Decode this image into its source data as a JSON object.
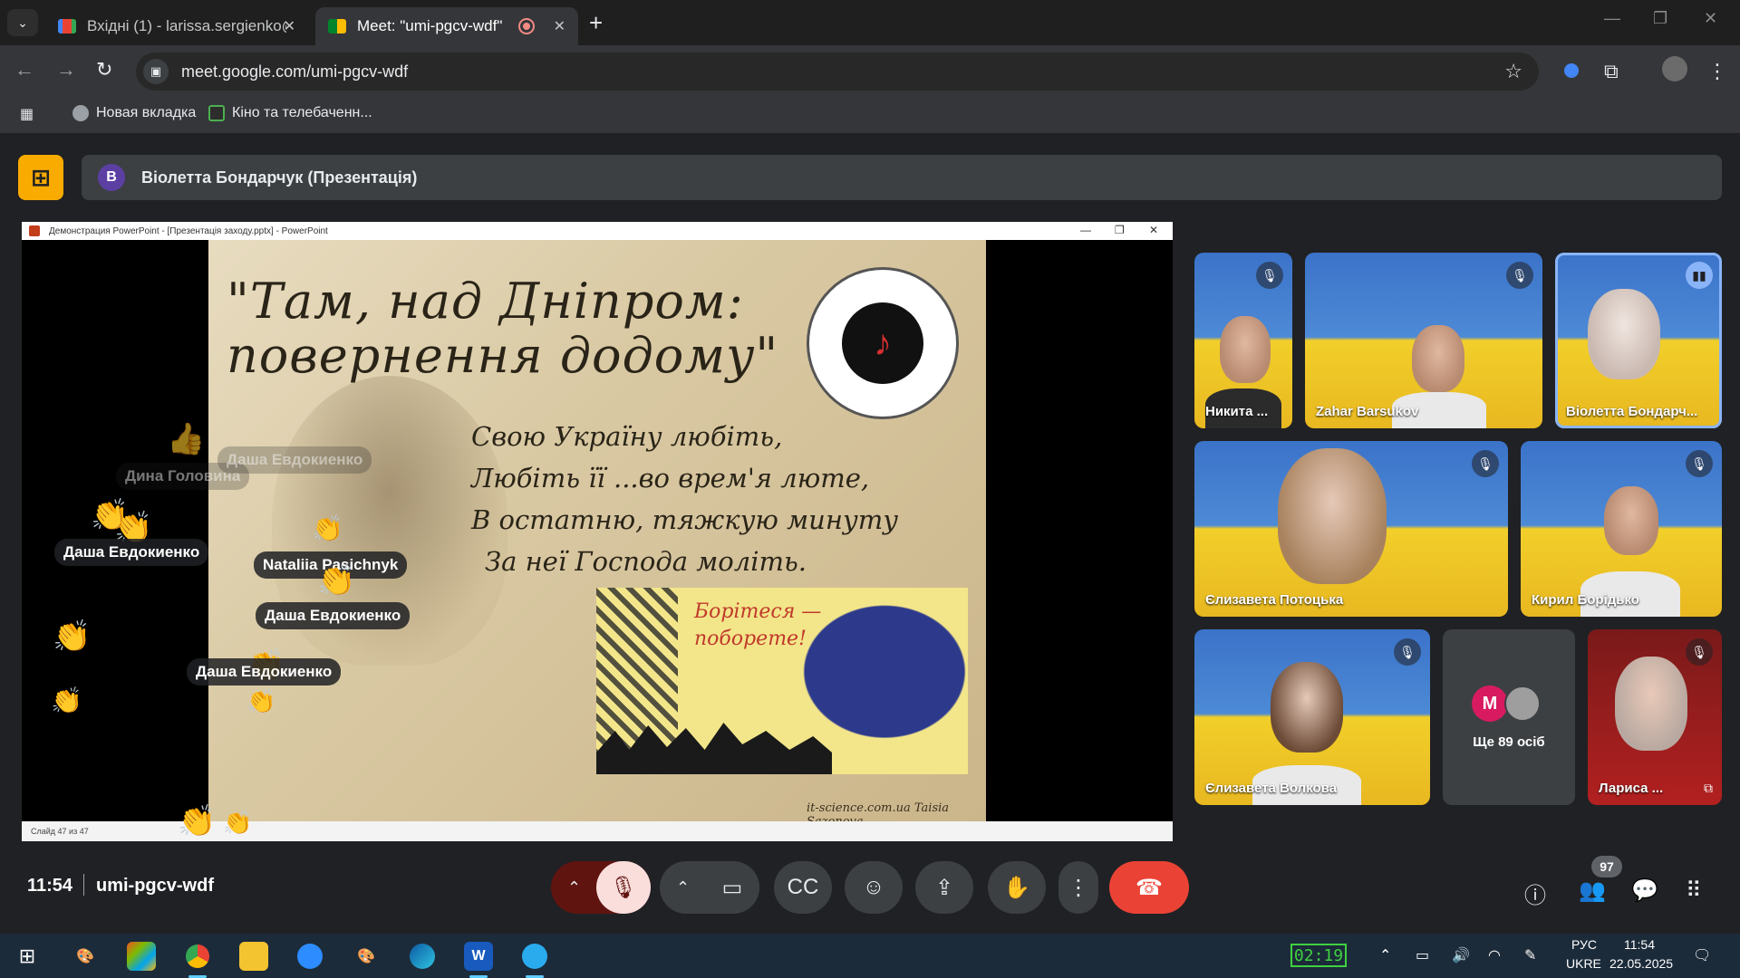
{
  "browser": {
    "tabs": [
      {
        "label": "Вхідні (1) - larissa.sergienko@g",
        "close": "✕"
      },
      {
        "label": "Meet: \"umi-pgcv-wdf\"",
        "close": "✕"
      }
    ],
    "new_tab": "+",
    "url": "meet.google.com/umi-pgcv-wdf",
    "bookmarks": [
      {
        "label": "Новая вкладка"
      },
      {
        "label": "Кіно та телебаченн..."
      }
    ]
  },
  "meet": {
    "presenter_initial": "В",
    "presenter_label": "Віолетта Бондарчук (Презентація)",
    "time": "11:54",
    "meeting_code": "umi-pgcv-wdf",
    "participants_count": "97",
    "accent": "#8ab4f8",
    "end_call_color": "#ea4335"
  },
  "slideshow": {
    "window_title": "Демонстрация PowerPoint - [Презентація заходу.pptx] - PowerPoint",
    "status": "Слайд 47 из 47",
    "title_line1": "\"Там, над Дніпром:",
    "title_line2": "повернення додому\"",
    "poem": [
      "Свою Україну любіть,",
      "Любіть її ...во врем'я люте,",
      "В остатню, тяжкую минуту",
      "За неї Господа моліть."
    ],
    "poster_line1": "Борітеся —",
    "poster_line2": "поборете!",
    "credit": "it-science.com.ua  Taisia Sazonova"
  },
  "reactions": [
    {
      "name": "Дина Головина",
      "faded": true
    },
    {
      "name": "Даша Евдокиенко",
      "faded": true
    },
    {
      "name": "Даша Евдокиенко",
      "faded": false
    },
    {
      "name": "Nataliia Pasichnyk",
      "faded": false
    },
    {
      "name": "Даша Евдокиенко",
      "faded": false
    },
    {
      "name": "Даша Евдокиенко",
      "faded": false
    }
  ],
  "tiles": [
    {
      "name": "Никита ...",
      "state": "muted"
    },
    {
      "name": "Zahar Barsukov",
      "state": "muted"
    },
    {
      "name": "Віолетта Бондарч...",
      "state": "speaking"
    },
    {
      "name": "Єлизавета Потоцька",
      "state": "muted"
    },
    {
      "name": "Кирил Борідько",
      "state": "muted"
    },
    {
      "name": "Єлизавета Волкова",
      "state": "muted"
    },
    {
      "name": "Ще 89 осіб",
      "state": "more",
      "initial": "M"
    },
    {
      "name": "Лариса ...",
      "state": "muted"
    }
  ],
  "taskbar": {
    "timer": "02:19",
    "lang1": "РУС",
    "lang2": "UKRE",
    "clock_time": "11:54",
    "clock_date": "22.05.2025"
  }
}
